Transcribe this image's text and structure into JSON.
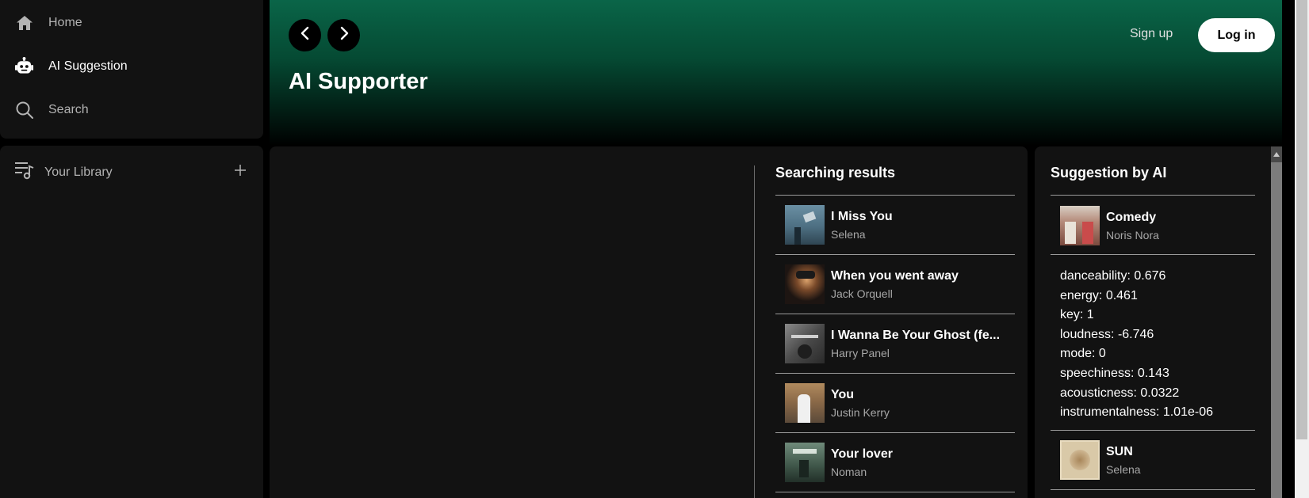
{
  "sidebar": {
    "nav": [
      {
        "label": "Home",
        "icon": "home-icon"
      },
      {
        "label": "AI Suggestion",
        "icon": "robot-icon"
      },
      {
        "label": "Search",
        "icon": "search-icon"
      }
    ],
    "library": {
      "label": "Your Library",
      "icon": "library-icon",
      "add_icon": "plus-icon"
    }
  },
  "header": {
    "title": "AI Supporter",
    "back_icon": "chevron-left-icon",
    "forward_icon": "chevron-right-icon",
    "signup_label": "Sign up",
    "login_label": "Log in"
  },
  "search_results": {
    "title": "Searching results",
    "items": [
      {
        "title": "I Miss You",
        "artist": "Selena"
      },
      {
        "title": "When you went away",
        "artist": "Jack Orquell"
      },
      {
        "title": "I Wanna Be Your Ghost (fe...",
        "artist": "Harry Panel"
      },
      {
        "title": "You",
        "artist": "Justin Kerry"
      },
      {
        "title": "Your lover",
        "artist": "Noman"
      }
    ]
  },
  "ai_suggestion": {
    "title": "Suggestion by AI",
    "tracks": [
      {
        "title": "Comedy",
        "artist": "Noris Nora"
      },
      {
        "title": "SUN",
        "artist": "Selena"
      }
    ],
    "features": [
      "danceability: 0.676",
      "energy: 0.461",
      "key: 1",
      "loudness: -6.746",
      "mode: 0",
      "speechiness: 0.143",
      "acousticness: 0.0322",
      "instrumentalness: 1.01e-06"
    ]
  },
  "colors": {
    "accent_green": "#0a6548",
    "card_bg": "#121212",
    "page_bg": "#000000",
    "muted_text": "#a7a7a7"
  }
}
